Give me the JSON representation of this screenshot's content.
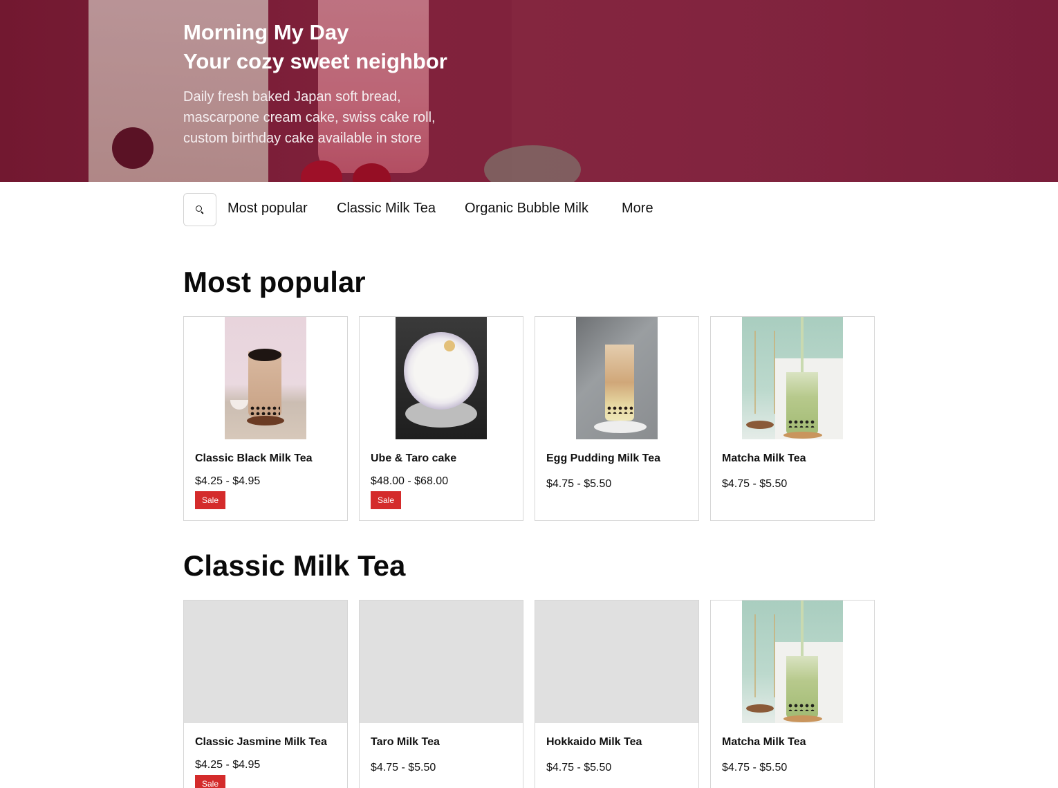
{
  "hero": {
    "title_line1": "Morning My Day",
    "title_line2": "Your cozy sweet neighbor",
    "description": "Daily fresh baked Japan soft bread, mascarpone cream cake, swiss cake roll, custom birthday cake available in store"
  },
  "nav": {
    "search_icon": "search-icon",
    "items": [
      "Most popular",
      "Classic Milk Tea",
      "Organic Bubble Milk",
      "More"
    ]
  },
  "sections": [
    {
      "title": "Most popular",
      "products": [
        {
          "name": "Classic Black Milk Tea",
          "price": "$4.25 - $4.95",
          "badge": "Sale"
        },
        {
          "name": "Ube & Taro cake",
          "price": "$48.00 - $68.00",
          "badge": "Sale"
        },
        {
          "name": "Egg Pudding Milk Tea",
          "price": "$4.75 - $5.50",
          "badge": ""
        },
        {
          "name": "Matcha Milk Tea",
          "price": "$4.75 - $5.50",
          "badge": ""
        }
      ]
    },
    {
      "title": "Classic Milk Tea",
      "products": [
        {
          "name": "Classic Jasmine Milk Tea",
          "price": "$4.25 - $4.95",
          "badge": "Sale"
        },
        {
          "name": "Taro Milk Tea",
          "price": "$4.75 - $5.50",
          "badge": ""
        },
        {
          "name": "Hokkaido Milk Tea",
          "price": "$4.75 - $5.50",
          "badge": ""
        },
        {
          "name": "Matcha Milk Tea",
          "price": "$4.75 - $5.50",
          "badge": ""
        }
      ]
    }
  ],
  "colors": {
    "hero": "#8a2a46",
    "sale_badge": "#d42b2b",
    "placeholder": "#e0e0e0",
    "card_border": "#d6d6d6"
  }
}
